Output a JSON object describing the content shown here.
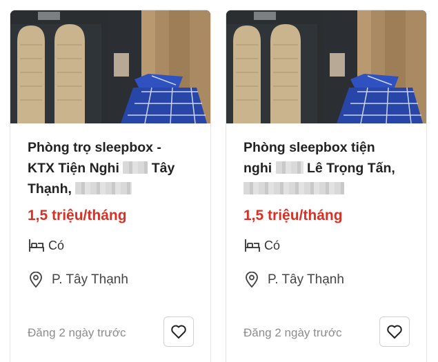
{
  "listings": [
    {
      "title_part1": "Phòng trọ sleepbox -",
      "title_part2": "KTX Tiện Nghi",
      "title_part3": "Tây",
      "title_part4": "Thạnh,",
      "price": "1,5 triệu/tháng",
      "feature_value": "Có",
      "location": "P. Tây Thạnh",
      "posted": "Đăng 2 ngày trước",
      "feature_icon": "furniture-icon",
      "location_icon": "map-pin-icon",
      "favorite_icon": "heart-icon"
    },
    {
      "title_part1": "Phòng sleepbox tiện",
      "title_part2": "nghi",
      "title_part3": "Lê Trọng Tấn,",
      "price": "1,5 triệu/tháng",
      "feature_value": "Có",
      "location": "P. Tây Thạnh",
      "posted": "Đăng 2 ngày trước",
      "feature_icon": "furniture-icon",
      "location_icon": "map-pin-icon",
      "favorite_icon": "heart-icon"
    }
  ],
  "colors": {
    "price": "#d93025",
    "title": "#222222",
    "muted": "#8c8c8c"
  }
}
